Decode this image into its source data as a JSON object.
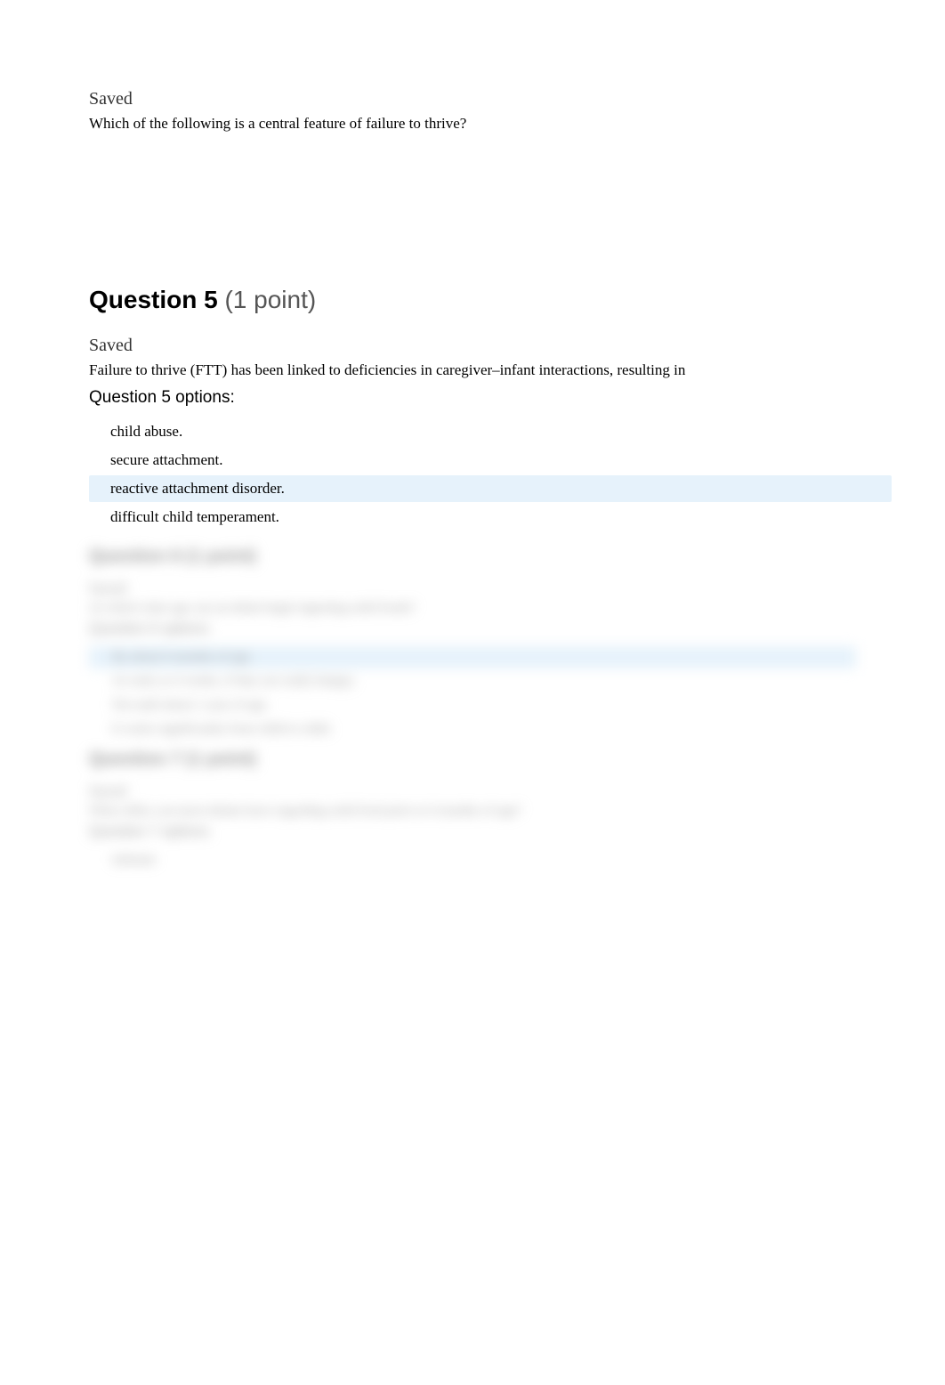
{
  "intro": {
    "saved": "Saved",
    "question_text": "Which of the following is a central feature of failure to thrive?"
  },
  "q5": {
    "heading_bold": "Question 5",
    "heading_light": " (1 point)",
    "saved": "Saved",
    "question_text": "Failure to thrive (FTT) has been linked to deficiencies in caregiver–infant interactions, resulting in",
    "options_label": "Question 5 options:",
    "options": [
      {
        "text": "child abuse.",
        "highlighted": false
      },
      {
        "text": "secure attachment.",
        "highlighted": false
      },
      {
        "text": "reactive attachment disorder.",
        "highlighted": true
      },
      {
        "text": "difficult child temperament.",
        "highlighted": false
      }
    ]
  },
  "blurred": {
    "q6": {
      "heading": "Question 6        (1 point)",
      "saved": "Saved",
      "question_text": "At which what age can an infant begin ingesting solid foods?",
      "options_label": "Question 6 options:",
      "options": [
        {
          "text": "By about 6 months of age.",
          "highlighted": true
        },
        {
          "text": "As early as 4 weeks, if they are really hungry.",
          "highlighted": false
        },
        {
          "text": "Not until about 1 year of age.",
          "highlighted": false
        },
        {
          "text": "It varies significantly from child to child.",
          "highlighted": false
        }
      ]
    },
    "q7": {
      "heading": "Question 7        (1 point)",
      "saved": "Saved",
      "question_text": "What reflex can most infants have regarding solid food prior to 6 months of age?",
      "options_label": "Question 7 options:",
      "options": [
        {
          "text": "intimate",
          "highlighted": false
        }
      ]
    }
  }
}
